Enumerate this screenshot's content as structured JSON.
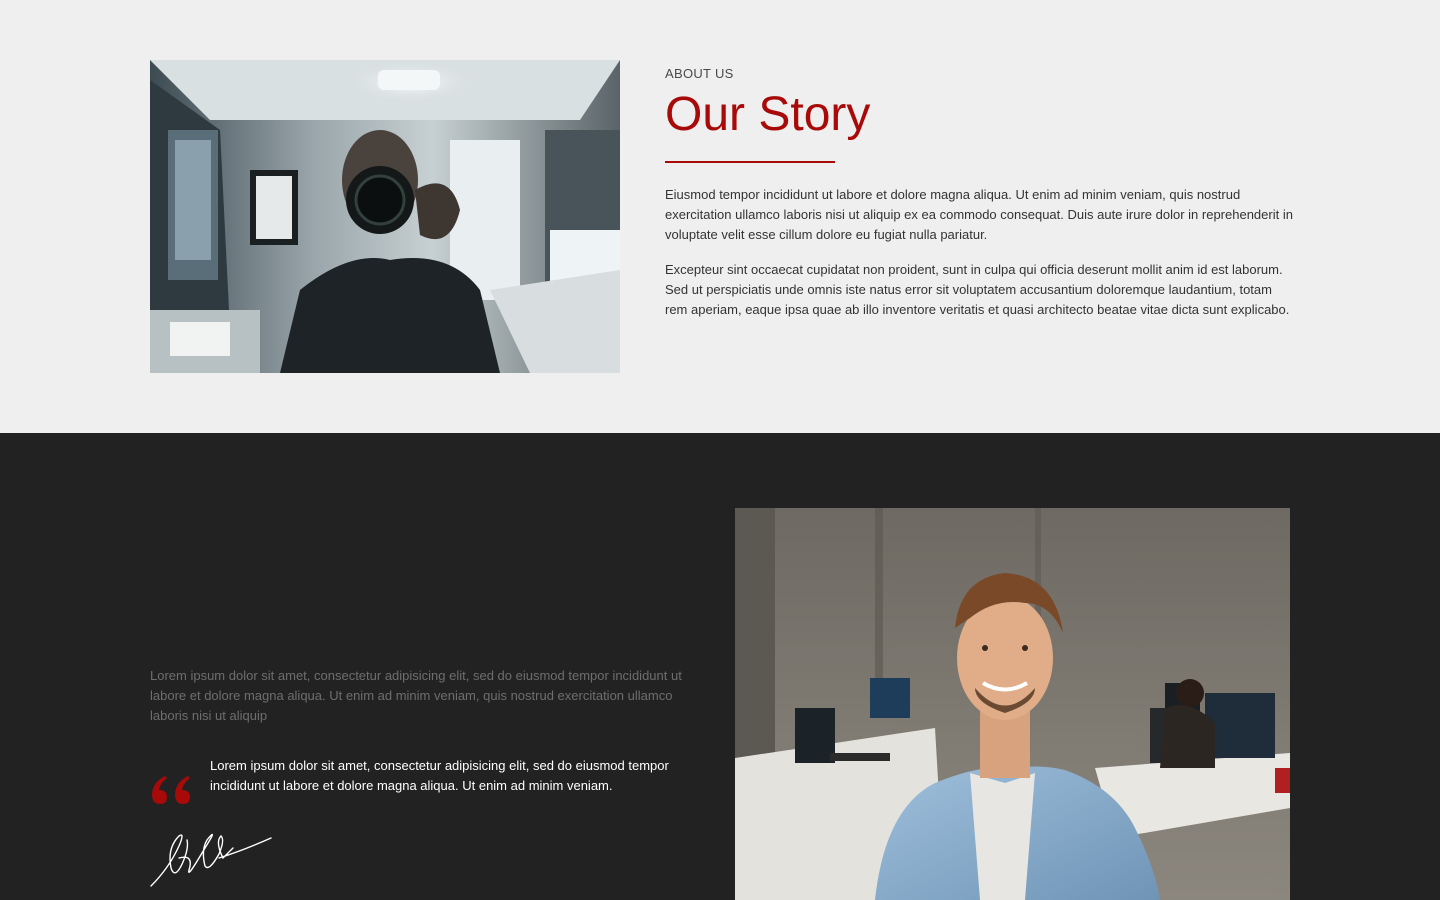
{
  "nav": {
    "scroll_icon": "arrow-down-icon"
  },
  "about": {
    "eyebrow": "ABOUT US",
    "title": "Our Story",
    "accent_color": "#a80a0a",
    "paragraphs": [
      "Eiusmod tempor incididunt ut labore et dolore magna aliqua. Ut enim ad minim veniam, quis nostrud exercitation ullamco laboris nisi ut aliquip ex ea commodo consequat. Duis aute irure dolor in reprehenderit in voluptate velit esse cillum dolore eu fugiat nulla pariatur.",
      "Excepteur sint occaecat cupidatat non proident, sunt in culpa qui officia deserunt mollit anim id est laborum. Sed ut perspiciatis unde omnis iste natus error sit voluptatem accusantium doloremque laudantium, totam rem aperiam, eaque ipsa quae ab illo inventore veritatis et quasi architecto beatae vitae dicta sunt explicabo."
    ],
    "image_icon": "photographer-photo"
  },
  "testimonial": {
    "intro": "Lorem ipsum dolor sit amet, consectetur adipisicing elit, sed do eiusmod tempor incididunt ut labore et dolore magna aliqua. Ut enim ad minim veniam, quis nostrud exercitation ullamco laboris nisi ut aliquip",
    "quote": "Lorem ipsum dolor sit amet, consectetur adipisicing elit, sed do eiusmod tempor incididunt ut labore et dolore magna aliqua. Ut enim ad minim veniam.",
    "quote_icon": "quote-icon",
    "signature_icon": "signature-image",
    "image_icon": "team-member-photo",
    "background_color": "#222222"
  }
}
